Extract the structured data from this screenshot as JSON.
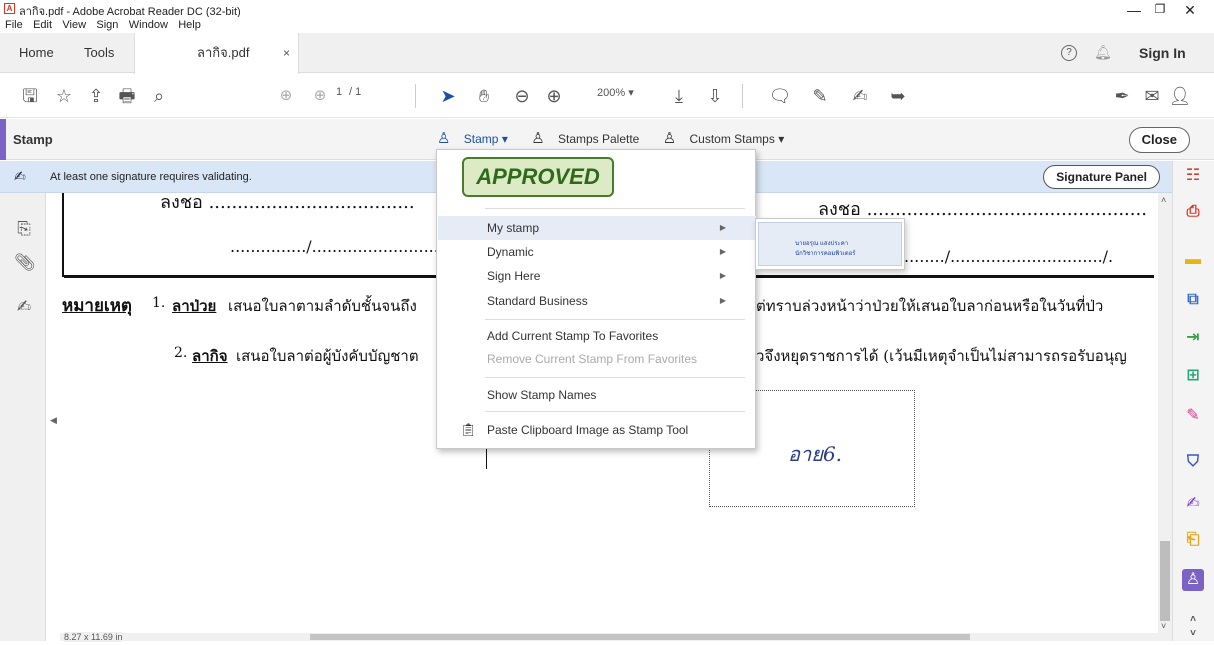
{
  "window": {
    "title": "ลากิจ.pdf - Adobe Acrobat Reader DC (32-bit)",
    "app_icon": "acrobat-icon",
    "controls": [
      "minimize",
      "restore",
      "close"
    ]
  },
  "menubar": [
    "File",
    "Edit",
    "View",
    "Sign",
    "Window",
    "Help"
  ],
  "tabs": {
    "home": "Home",
    "tools": "Tools",
    "document": "ลากิจ.pdf",
    "close_glyph": "×",
    "sign_in": "Sign In"
  },
  "toolbar": {
    "page_current": "1",
    "page_total": "/ 1",
    "zoom": "200%"
  },
  "stampbar": {
    "label": "Stamp",
    "stamp_menu": "Stamp ▾",
    "stamps_palette": "Stamps Palette",
    "custom_stamps": "Custom Stamps ▾",
    "close": "Close"
  },
  "signature_bar": {
    "message": "At least one signature requires validating.",
    "panel_button": "Signature Panel"
  },
  "stamp_menu": {
    "preview_stamp": "APPROVED",
    "items": [
      {
        "label": "My stamp",
        "submenu": true,
        "highlighted": true
      },
      {
        "label": "Dynamic",
        "submenu": true
      },
      {
        "label": "Sign Here",
        "submenu": true
      },
      {
        "label": "Standard Business",
        "submenu": true
      },
      {
        "label": "Add Current Stamp To Favorites"
      },
      {
        "label": "Remove Current Stamp From Favorites",
        "disabled": true
      },
      {
        "label": "Show Stamp Names"
      },
      {
        "label": "Paste Clipboard Image as Stamp Tool"
      }
    ]
  },
  "submenu": {
    "line1": "นายอรุณ แสงประคา",
    "line2": "นักวิชาการคอมพิวเตอร์"
  },
  "document": {
    "top_left": "ลงชอ ....................................",
    "top_right": "ลงชอ .................................................",
    "date_left": ".............../...........................",
    "date_right": "......../............................../.",
    "note_heading": "หมายเหตุ",
    "note1_num": "1.",
    "note1_bold": "ลาป่วย",
    "note1_text": "เสนอใบลาตามลำดับชั้นจนถึง",
    "note1_tail": "ต่ทราบล่วงหน้าว่าป่วยให้เสนอใบลาก่อนหรือในวันที่ป่ว",
    "note2_num": "2.",
    "note2_bold": "ลากิจ",
    "note2_text": "เสนอใบลาต่อผู้บังคับบัญชาต",
    "note2_tail": "วจึงหยุดราชการได้ (เว้นมีเหตุจำเป็นไม่สามารถรอรับอนุญ",
    "signature": "อาย6."
  },
  "status": {
    "page_size": "8.27 x 11.69 in"
  }
}
